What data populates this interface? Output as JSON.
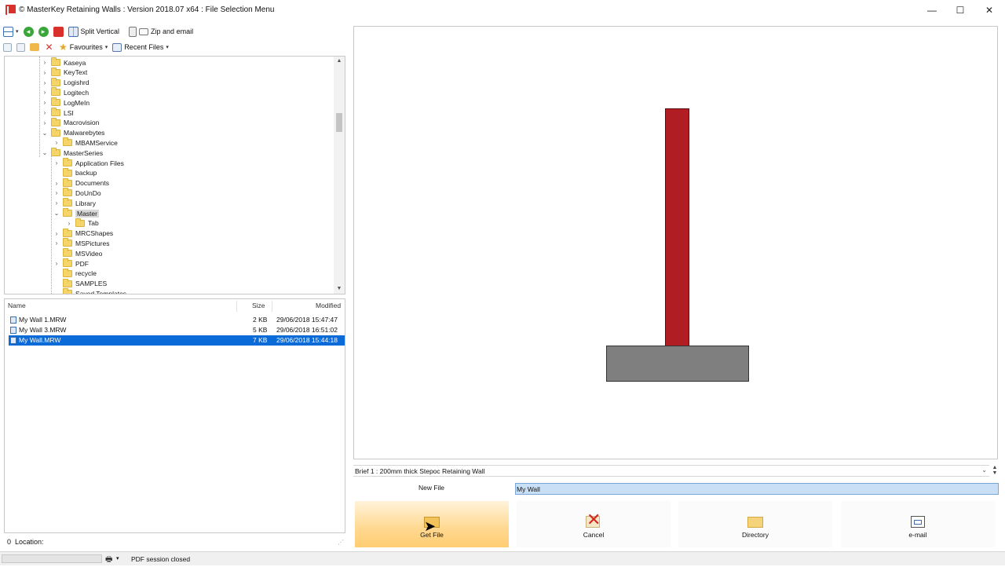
{
  "window": {
    "title": "© MasterKey Retaining Walls : Version 2018.07 x64 : File Selection Menu",
    "controls": [
      "—",
      "☐",
      "✕"
    ]
  },
  "toolbar": {
    "split_vertical": "Split Vertical",
    "zip_email": "Zip and email",
    "favourites": "Favourites",
    "recent_files": "Recent Files"
  },
  "tree": {
    "items": [
      {
        "label": "Kaseya",
        "level": 2,
        "expander": "›"
      },
      {
        "label": "KeyText",
        "level": 2,
        "expander": "›"
      },
      {
        "label": "Logishrd",
        "level": 2,
        "expander": "›"
      },
      {
        "label": "Logitech",
        "level": 2,
        "expander": "›"
      },
      {
        "label": "LogMeIn",
        "level": 2,
        "expander": "›"
      },
      {
        "label": "LSI",
        "level": 2,
        "expander": "›"
      },
      {
        "label": "Macrovision",
        "level": 2,
        "expander": "›"
      },
      {
        "label": "Malwarebytes",
        "level": 2,
        "expander": "⌄"
      },
      {
        "label": "MBAMService",
        "level": 3,
        "expander": "›"
      },
      {
        "label": "MasterSeries",
        "level": 2,
        "expander": "⌄"
      },
      {
        "label": "Application Files",
        "level": 3,
        "expander": "›"
      },
      {
        "label": "backup",
        "level": 3,
        "expander": ""
      },
      {
        "label": "Documents",
        "level": 3,
        "expander": "›"
      },
      {
        "label": "DoUnDo",
        "level": 3,
        "expander": "›"
      },
      {
        "label": "Library",
        "level": 3,
        "expander": "›"
      },
      {
        "label": "Master",
        "level": 3,
        "expander": "⌄",
        "selected": true
      },
      {
        "label": "Tab",
        "level": 4,
        "expander": "›"
      },
      {
        "label": "MRCShapes",
        "level": 3,
        "expander": "›"
      },
      {
        "label": "MSPictures",
        "level": 3,
        "expander": "›"
      },
      {
        "label": "MSVideo",
        "level": 3,
        "expander": ""
      },
      {
        "label": "PDF",
        "level": 3,
        "expander": "›"
      },
      {
        "label": "recycle",
        "level": 3,
        "expander": ""
      },
      {
        "label": "SAMPLES",
        "level": 3,
        "expander": ""
      },
      {
        "label": "Saved Templates",
        "level": 3,
        "expander": ""
      }
    ]
  },
  "filelist": {
    "headers": {
      "name": "Name",
      "size": "Size",
      "modified": "Modified"
    },
    "rows": [
      {
        "name": "My Wall 1.MRW",
        "size": "2 KB",
        "modified": "29/06/2018 15:47:47"
      },
      {
        "name": "My Wall 3.MRW",
        "size": "5 KB",
        "modified": "29/06/2018 16:51:02"
      },
      {
        "name": "My Wall.MRW",
        "size": "7 KB",
        "modified": "29/06/2018 15:44:18",
        "selected": true
      }
    ]
  },
  "location": {
    "count": "0",
    "label": "Location:"
  },
  "status": {
    "message": "PDF session closed"
  },
  "brief": {
    "text": "Brief 1 : 200mm thick Stepoc Retaining Wall"
  },
  "new_file": {
    "label": "New File",
    "value": "My Wall"
  },
  "buttons": {
    "get_file": "Get File",
    "cancel": "Cancel",
    "directory": "Directory",
    "email": "e-mail"
  },
  "colors": {
    "wall_stem": "#b01e23",
    "wall_base": "#7f7f7f",
    "selection": "#0a6ad8"
  }
}
